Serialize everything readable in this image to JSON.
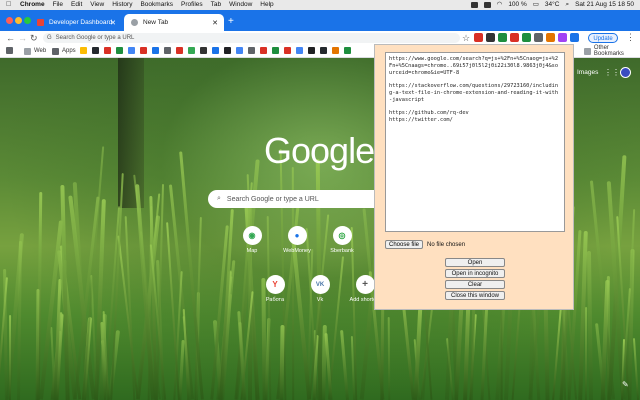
{
  "menubar": {
    "app": "Chrome",
    "items": [
      "File",
      "Edit",
      "View",
      "History",
      "Bookmarks",
      "Profiles",
      "Tab",
      "Window",
      "Help"
    ],
    "battery": "100 %",
    "temperature": "34°C",
    "datetime": "Sat 21 Aug  15 18 50"
  },
  "tabs": [
    {
      "title": "Developer Dashboard",
      "active": false
    },
    {
      "title": "New Tab",
      "active": true
    }
  ],
  "toolbar": {
    "omnibox_placeholder": "Search Google or type a URL",
    "update_label": "Update"
  },
  "bookmarks": {
    "items": [
      "Web",
      "Apps"
    ],
    "other": "Other Bookmarks"
  },
  "ntp": {
    "logo": "Google",
    "images_link": "Images",
    "search_placeholder": "Search Google or type a URL",
    "shortcuts": [
      {
        "label": "Map",
        "glyph": "◉",
        "color": "#34a853"
      },
      {
        "label": "WebMoney",
        "glyph": "●",
        "color": "#1a73e8"
      },
      {
        "label": "Sberbank",
        "glyph": "◎",
        "color": "#21a038"
      },
      {
        "label": "Работа",
        "glyph": "Y",
        "color": "#ea4335"
      },
      {
        "label": "Vk",
        "glyph": "VK",
        "color": "#4a76a8"
      },
      {
        "label": "Add shortcut",
        "glyph": "+",
        "color": "#555555"
      }
    ]
  },
  "popup": {
    "textarea_value": "https://www.google.com/search?q=js+%2Fn+%5Cnaog=js+%2Fn+%5Cnaags=chrome..69i57j0l5l2j0i22i30l8.9863j0j4&sourceid=chrome&ie=UTF-8\n\nhttps://stackoverflow.com/questions/29723160/including-a-text-file-in-chrome-extension-and-reading-it-with-javascript\n\nhttps://github.com/rq-dev\nhttps://twitter.com/",
    "choose_file_label": "Choose file",
    "no_file_label": "No file chosen",
    "buttons": [
      "Open",
      "Open in incognito",
      "Clear",
      "Close this window"
    ]
  },
  "colors": {
    "tab_strip": "#1a73e8",
    "popup_bg": "#ffe0c0"
  }
}
